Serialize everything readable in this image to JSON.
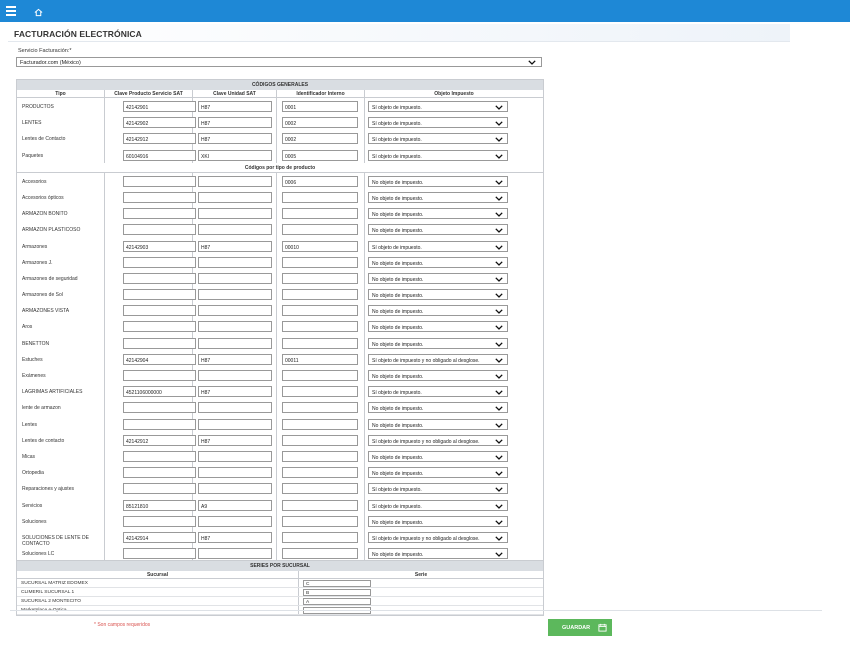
{
  "header": {
    "menu_icon": "hamburger-icon",
    "home_icon": "home-icon"
  },
  "page": {
    "title": "FACTURACIÓN ELECTRÓNICA"
  },
  "service": {
    "label": "Servicio Facturación:*",
    "value": "Facturador.com (México)"
  },
  "general": {
    "section_title": "CÓDIGOS GENERALES",
    "columns": [
      "Tipo",
      "Clave Producto Servicio SAT",
      "Clave Unidad SAT",
      "Identificador Interno",
      "Objeto Impuesto"
    ],
    "rows": [
      {
        "tipo": "PRODUCTOS",
        "clave_producto": "42142901",
        "clave_unidad": "H87",
        "identificador": "0001",
        "objeto": "Sí objeto de impuesto."
      },
      {
        "tipo": "LENTES",
        "clave_producto": "42142902",
        "clave_unidad": "H87",
        "identificador": "0002",
        "objeto": "Sí objeto de impuesto."
      },
      {
        "tipo": "Lentes de Contacto",
        "clave_producto": "42142912",
        "clave_unidad": "H87",
        "identificador": "0002",
        "objeto": "Sí objeto de impuesto."
      },
      {
        "tipo": "Paquetes",
        "clave_producto": "60104916",
        "clave_unidad": "XKI",
        "identificador": "0005",
        "objeto": "Sí objeto de impuesto."
      }
    ]
  },
  "by_type": {
    "section_title": "Códigos por tipo de producto",
    "rows": [
      {
        "tipo": "Accesorios",
        "clave_producto": "",
        "clave_unidad": "",
        "identificador": "0006",
        "objeto": "No objeto de impuesto."
      },
      {
        "tipo": "Accesorios ópticos",
        "clave_producto": "",
        "clave_unidad": "",
        "identificador": "",
        "objeto": "No objeto de impuesto."
      },
      {
        "tipo": "ARMAZON BONITO",
        "clave_producto": "",
        "clave_unidad": "",
        "identificador": "",
        "objeto": "No objeto de impuesto."
      },
      {
        "tipo": "ARMAZON PLASTICOSO",
        "clave_producto": "",
        "clave_unidad": "",
        "identificador": "",
        "objeto": "No objeto de impuesto."
      },
      {
        "tipo": "Armazones",
        "clave_producto": "42142903",
        "clave_unidad": "H87",
        "identificador": "00010",
        "objeto": "Sí objeto de impuesto."
      },
      {
        "tipo": "Armazones J.",
        "clave_producto": "",
        "clave_unidad": "",
        "identificador": "",
        "objeto": "No objeto de impuesto."
      },
      {
        "tipo": "Armazones de seguridad",
        "clave_producto": "",
        "clave_unidad": "",
        "identificador": "",
        "objeto": "No objeto de impuesto."
      },
      {
        "tipo": "Armazones de Sol",
        "clave_producto": "",
        "clave_unidad": "",
        "identificador": "",
        "objeto": "No objeto de impuesto."
      },
      {
        "tipo": "ARMAZONES VISTA",
        "clave_producto": "",
        "clave_unidad": "",
        "identificador": "",
        "objeto": "No objeto de impuesto."
      },
      {
        "tipo": "Aros",
        "clave_producto": "",
        "clave_unidad": "",
        "identificador": "",
        "objeto": "No objeto de impuesto."
      },
      {
        "tipo": "BENETTON",
        "clave_producto": "",
        "clave_unidad": "",
        "identificador": "",
        "objeto": "No objeto de impuesto."
      },
      {
        "tipo": "Estuches",
        "clave_producto": "42142904",
        "clave_unidad": "H87",
        "identificador": "00011",
        "objeto": "Sí objeto de impuesto y no obligado al desglose."
      },
      {
        "tipo": "Exámenes",
        "clave_producto": "",
        "clave_unidad": "",
        "identificador": "",
        "objeto": "No objeto de impuesto."
      },
      {
        "tipo": "LAGRIMAS ARTIFICIALES",
        "clave_producto": "4521106000000",
        "clave_unidad": "H87",
        "identificador": "",
        "objeto": "Sí objeto de impuesto."
      },
      {
        "tipo": "lente de armazon",
        "clave_producto": "",
        "clave_unidad": "",
        "identificador": "",
        "objeto": "No objeto de impuesto."
      },
      {
        "tipo": "Lentes",
        "clave_producto": "",
        "clave_unidad": "",
        "identificador": "",
        "objeto": "No objeto de impuesto."
      },
      {
        "tipo": "Lentes de contacto",
        "clave_producto": "42142912",
        "clave_unidad": "H87",
        "identificador": "",
        "objeto": "Sí objeto de impuesto y no obligado al desglose."
      },
      {
        "tipo": "Micas",
        "clave_producto": "",
        "clave_unidad": "",
        "identificador": "",
        "objeto": "No objeto de impuesto."
      },
      {
        "tipo": "Ortopedia",
        "clave_producto": "",
        "clave_unidad": "",
        "identificador": "",
        "objeto": "No objeto de impuesto."
      },
      {
        "tipo": "Reparaciones y ajustes",
        "clave_producto": "",
        "clave_unidad": "",
        "identificador": "",
        "objeto": "Sí objeto de impuesto."
      },
      {
        "tipo": "Servicios",
        "clave_producto": "85121810",
        "clave_unidad": "A9",
        "identificador": "",
        "objeto": "Sí objeto de impuesto."
      },
      {
        "tipo": "Soluciones",
        "clave_producto": "",
        "clave_unidad": "",
        "identificador": "",
        "objeto": "No objeto de impuesto."
      },
      {
        "tipo": "SOLUCIONES DE LENTE DE CONTACTO",
        "clave_producto": "42142914",
        "clave_unidad": "H87",
        "identificador": "",
        "objeto": "Sí objeto de impuesto y no obligado al desglose."
      },
      {
        "tipo": "Soluciones LC",
        "clave_producto": "",
        "clave_unidad": "",
        "identificador": "",
        "objeto": "No objeto de impuesto."
      }
    ]
  },
  "series": {
    "section_title": "SERIES POR SUCURSAL",
    "columns": [
      "Sucursal",
      "Serie"
    ],
    "rows": [
      {
        "sucursal": "SUCURSAL MATRIZ EDOMEX",
        "serie": "C"
      },
      {
        "sucursal": "CLIMERIL SUCURSAL 1",
        "serie": "B"
      },
      {
        "sucursal": "SUCURSAL 2 MONTECITO",
        "serie": "A"
      },
      {
        "sucursal": "Marketplace e-Optica",
        "serie": ""
      }
    ]
  },
  "footer": {
    "required_note": "* Son campos requeridos",
    "save_label": "GUARDAR",
    "save_icon": "calendar-save-icon"
  },
  "colors": {
    "topbar": "#1e88d6",
    "save": "#5cb85c",
    "required": "#d9534f",
    "section_header": "#d9dde2"
  }
}
